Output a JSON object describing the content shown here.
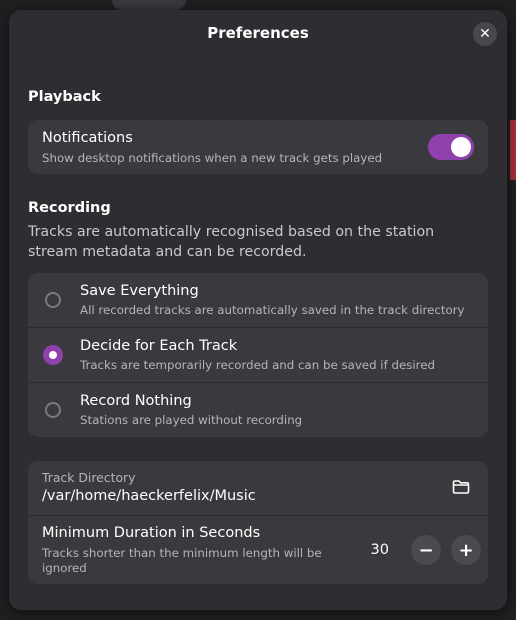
{
  "dialog": {
    "title": "Preferences",
    "close_icon": "close-icon"
  },
  "playback": {
    "section_title": "Playback",
    "notifications": {
      "title": "Notifications",
      "subtitle": "Show desktop notifications when a new track gets played",
      "enabled": true
    }
  },
  "recording": {
    "section_title": "Recording",
    "description": "Tracks are automatically recognised based on the station stream metadata and can be recorded.",
    "options": [
      {
        "title": "Save Everything",
        "subtitle": "All recorded tracks are automatically saved in the track directory",
        "selected": false
      },
      {
        "title": "Decide for Each Track",
        "subtitle": "Tracks are temporarily recorded and can be saved if desired",
        "selected": true
      },
      {
        "title": "Record Nothing",
        "subtitle": "Stations are played without recording",
        "selected": false
      }
    ]
  },
  "settings": {
    "track_directory": {
      "label": "Track Directory",
      "value": "/var/home/haeckerfelix/Music",
      "icon": "folder-icon"
    },
    "min_duration": {
      "title": "Minimum Duration in Seconds",
      "subtitle": "Tracks shorter than the minimum length will be ignored",
      "value": "30",
      "decrement_label": "−",
      "increment_label": "+"
    }
  },
  "colors": {
    "accent": "#9141ac",
    "dialog_bg": "#2e2e32",
    "card_bg": "#3a3a3e"
  }
}
